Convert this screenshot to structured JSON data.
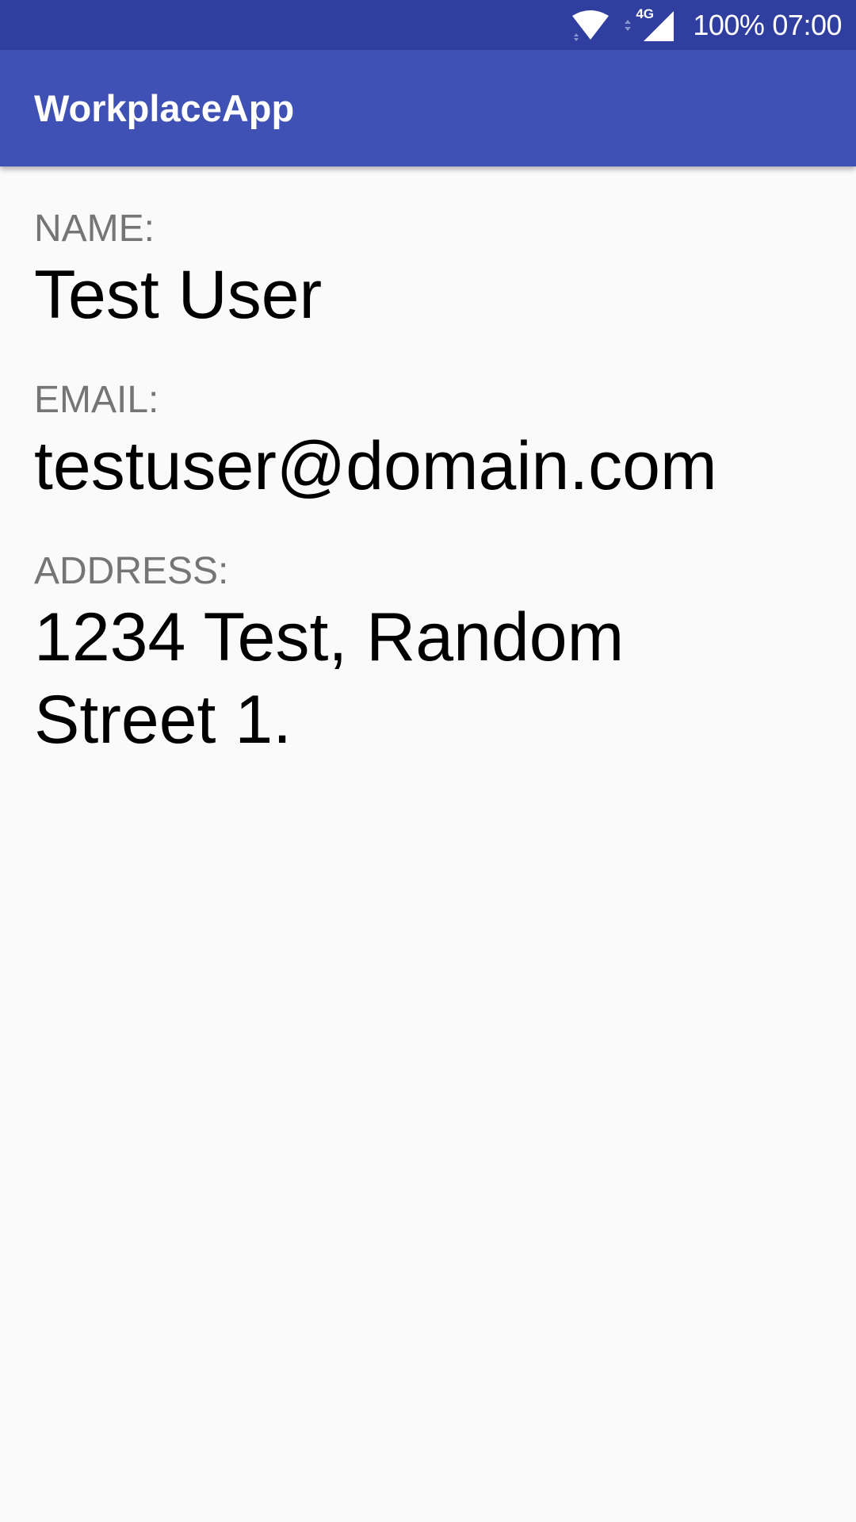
{
  "status_bar": {
    "network_type": "4G",
    "battery": "100%",
    "time": "07:00",
    "icons": [
      "wifi-icon",
      "cell-signal-icon"
    ]
  },
  "app_bar": {
    "title": "WorkplaceApp",
    "color": "#3f51b5",
    "status_color": "#303f9f"
  },
  "profile": {
    "name_label": "NAME:",
    "name_value": "Test User",
    "email_label": "EMAIL:",
    "email_value": "testuser@domain.com",
    "address_label": "ADDRESS:",
    "address_line1": "1234 Test, Random",
    "address_line2": "Street 1."
  }
}
